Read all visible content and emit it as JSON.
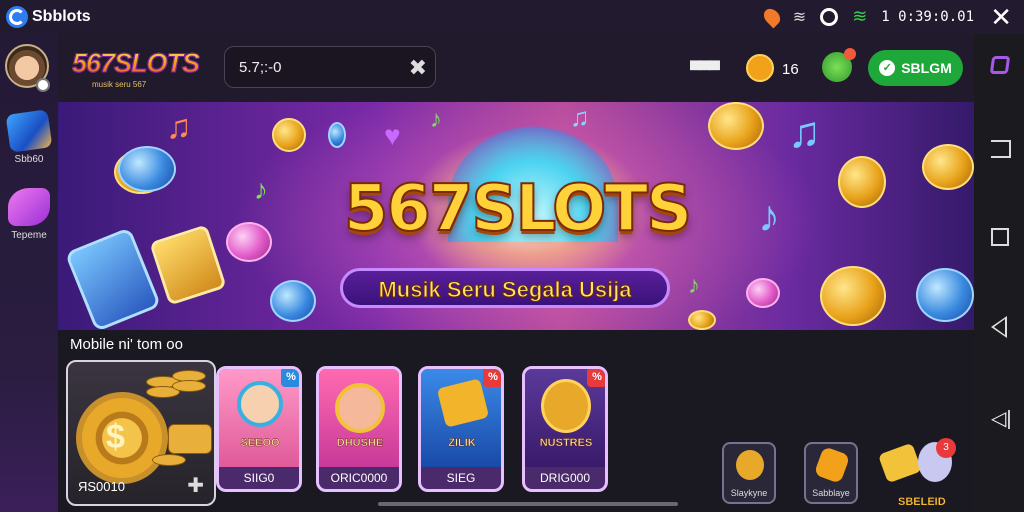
{
  "status_bar": {
    "app_title": "Sbblots",
    "time": "1 0:39:0.01",
    "icons": [
      "location-icon",
      "wifi-icon",
      "circle-icon",
      "wifi-signal-icon"
    ]
  },
  "sidebar": {
    "items": [
      {
        "label": "Sbb60",
        "icon": "gem-icon"
      },
      {
        "label": "Tepeme",
        "icon": "music-icon"
      }
    ]
  },
  "header": {
    "logo": "567SLOTS",
    "logo_sub": "musik seru 567",
    "search_value": "5.7;:-0",
    "coin_count": "16",
    "login_label": "SBLGM"
  },
  "banner": {
    "title": "567SLOTS",
    "subtitle": "Musik Seru Segala Usija"
  },
  "section": {
    "title": "Mobile ni' tom oo"
  },
  "featured": {
    "label": "ЯS0010"
  },
  "games": [
    {
      "title": "SEEOO",
      "label": "SIIG0",
      "badge": "%"
    },
    {
      "title": "DHUSHE",
      "label": "ORIC0000",
      "badge": ""
    },
    {
      "title": "ZILIK",
      "label": "SIEG",
      "badge": "%"
    },
    {
      "title": "NUSTRES",
      "label": "DRIG000",
      "badge": "%"
    }
  ],
  "mini_tiles": [
    {
      "label": "Slaykyne"
    },
    {
      "label": "Sabblaye"
    }
  ],
  "bonus": {
    "label": "SBELEID",
    "badge": "3"
  },
  "colors": {
    "accent_green": "#1fa83a",
    "brand_gold": "#ffd23a",
    "background": "#1a1426"
  }
}
